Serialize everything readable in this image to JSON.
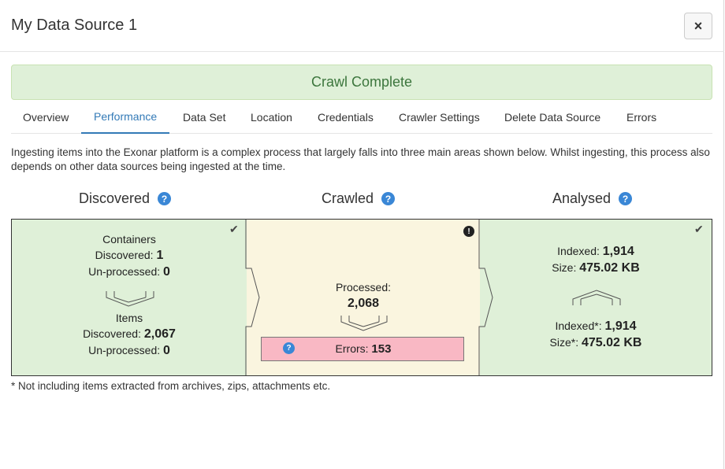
{
  "modal": {
    "title": "My Data Source 1",
    "close_label": "×"
  },
  "status": {
    "text": "Crawl Complete",
    "color": "#3c763d"
  },
  "tabs": [
    {
      "label": "Overview",
      "active": false
    },
    {
      "label": "Performance",
      "active": true
    },
    {
      "label": "Data Set",
      "active": false
    },
    {
      "label": "Location",
      "active": false
    },
    {
      "label": "Credentials",
      "active": false
    },
    {
      "label": "Crawler Settings",
      "active": false
    },
    {
      "label": "Delete Data Source",
      "active": false
    },
    {
      "label": "Errors",
      "active": false
    }
  ],
  "intro": "Ingesting items into the Exonar platform is a complex process that largely falls into three main areas shown below. Whilst ingesting, this process also depends on other data sources being ingested at the time.",
  "stages": {
    "discovered": {
      "title": "Discovered",
      "containers_label": "Containers",
      "containers_discovered_label": "Discovered:",
      "containers_discovered_value": "1",
      "containers_unprocessed_label": "Un-processed:",
      "containers_unprocessed_value": "0",
      "items_label": "Items",
      "items_discovered_label": "Discovered:",
      "items_discovered_value": "2,067",
      "items_unprocessed_label": "Un-processed:",
      "items_unprocessed_value": "0",
      "status_icon": "check-icon"
    },
    "crawled": {
      "title": "Crawled",
      "processed_label": "Processed:",
      "processed_value": "2,068",
      "errors_label": "Errors:",
      "errors_value": "153",
      "status_icon": "warning-icon"
    },
    "analysed": {
      "title": "Analysed",
      "indexed_label": "Indexed:",
      "indexed_value": "1,914",
      "size_label": "Size:",
      "size_value": "475.02 KB",
      "indexed_star_label": "Indexed*:",
      "indexed_star_value": "1,914",
      "size_star_label": "Size*:",
      "size_star_value": "475.02 KB",
      "status_icon": "check-icon"
    }
  },
  "footnote": "* Not including items extracted from archives, zips, attachments etc.",
  "colors": {
    "accent": "#337ab7",
    "success_bg": "#dff0d8",
    "pending_bg": "#faf5df",
    "error_bg": "#f9b8c4",
    "help_icon": "#3a87d6"
  }
}
